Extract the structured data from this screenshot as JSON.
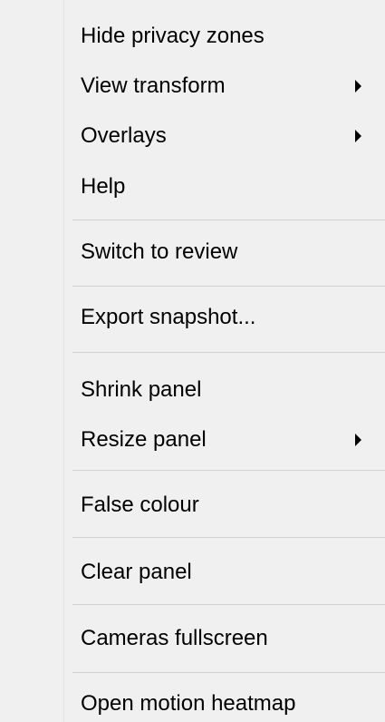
{
  "menu": {
    "items": [
      {
        "label": "Hide privacy zones",
        "submenu": false
      },
      {
        "label": "View transform",
        "submenu": true
      },
      {
        "label": "Overlays",
        "submenu": true
      },
      {
        "label": "Help",
        "submenu": false
      },
      {
        "label": "Switch to review",
        "submenu": false
      },
      {
        "label": "Export snapshot...",
        "submenu": false
      },
      {
        "label": "Shrink panel",
        "submenu": false
      },
      {
        "label": "Resize panel",
        "submenu": true
      },
      {
        "label": "False colour",
        "submenu": false
      },
      {
        "label": "Clear panel",
        "submenu": false
      },
      {
        "label": "Cameras fullscreen",
        "submenu": false
      },
      {
        "label": "Open motion heatmap",
        "submenu": false
      }
    ],
    "submenu_arrow_icon": "triangle-right-icon",
    "colors": {
      "background": "#f0f0f0",
      "text": "#000000",
      "separator": "#d2d2d2"
    }
  }
}
